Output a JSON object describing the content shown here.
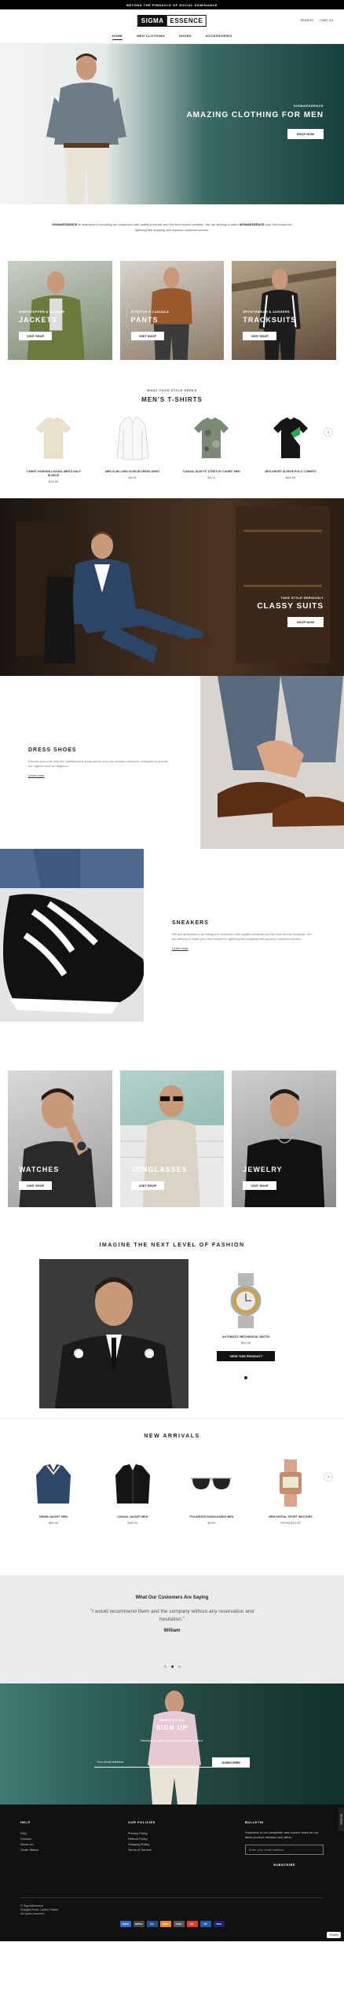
{
  "topbar": {
    "text": "BEYOND THE PINNACLE OF SOCIAL DOMINANCE"
  },
  "header": {
    "logo_part1": "SIGMA",
    "logo_part2": "ESSENCE",
    "search_label": "SEARCH",
    "cart_label": "CART (0)",
    "nav": [
      "HOME",
      "MEN CLOTHING",
      "SHOES",
      "ACCESSORIES"
    ]
  },
  "hero": {
    "kicker": "SIGMAESSENCE",
    "title": "AMAZING CLOTHING FOR MEN",
    "button": "SHOP NOW"
  },
  "intro": {
    "brand": "SIGMAESSENCE",
    "text1": " is dedicated to providing our customers with quality products and the best service possible. We are striving to make ",
    "brand2": "SIGMAESSENCE",
    "text2": " your first choice for lightning fast shipping and superior customer service."
  },
  "categories_top": [
    {
      "kicker": "WINDSTOPPER & BOMBER",
      "title": "JACKETS",
      "button": "VISIT SHOP"
    },
    {
      "kicker": "STRETCH & CASUALS",
      "title": "PANTS",
      "button": "VISIT SHOP"
    },
    {
      "kicker": "SPORTSWEAR & JOGGERS",
      "title": "TRACKSUITS",
      "button": "VISIT SHOP"
    }
  ],
  "tshirts": {
    "kicker": "WHAT YOUR STYLE SEEKS",
    "title": "MEN'S T-SHIRTS",
    "products": [
      {
        "name": "T-SHIRT FASHION CASUAL MEN'S HALF SLEEVE",
        "price": "$14.99"
      },
      {
        "name": "MEN SLIM LONG SLEEVE DRESS SHIRT",
        "price": "$9.99"
      },
      {
        "name": "CASUAL SLIM FIT STRETCH T-SHIRT MEN",
        "price": "$8.72"
      },
      {
        "name": "MEN SHORT SLEEVE POLO T-SHIRTS",
        "price": "$16.99"
      }
    ]
  },
  "suits": {
    "kicker": "TAKE STYLE SERIOUSLY",
    "title": "CLASSY SUITS",
    "button": "SHOP NOW"
  },
  "dress_shoes": {
    "title": "DRESS SHOES",
    "desc": "Elevate your look with the sophisticated dress shoes from our curated collection, designed to provide the highest level of elegance.",
    "link": "Learn more"
  },
  "sneakers": {
    "title": "SNEAKERS",
    "desc": "We are dedicated to providing our customers with quality products and the best service possible. We are striving to make your first choice for lightning fast shipping and superior customer service.",
    "link": "Learn more"
  },
  "categories_bottom": [
    {
      "title": "WATCHES",
      "button": "VISIT SHOP"
    },
    {
      "title": "SUNGLASSES",
      "button": "VISIT SHOP"
    },
    {
      "title": "JEWELRY",
      "button": "VISIT SHOP"
    }
  ],
  "fashion": {
    "title": "IMAGINE THE NEXT LEVEL OF FASHION",
    "product_name": "AUTOMATIC MECHANICAL WATCH",
    "product_price": "$54.99",
    "button": "VIEW THIS PRODUCT"
  },
  "arrivals": {
    "title": "NEW ARRIVALS",
    "products": [
      {
        "name": "DENIM JACKET MEN",
        "price": "$56.99"
      },
      {
        "name": "CASUAL JACKET MEN",
        "price": "$39.99"
      },
      {
        "name": "POLARIZED SUNGLASSES MEN",
        "price": "$8.99"
      },
      {
        "name": "MEN DIGITAL SPORT WATCHES",
        "price": "FROM $19.99"
      }
    ]
  },
  "testimonial": {
    "heading": "What Our Customers Are Saying",
    "quote": "\"I would recommend them and the company without any reservation and hesitation.\"",
    "author": "William"
  },
  "newsletter": {
    "kicker": "NEWSLETTER",
    "title": "SIGN UP",
    "desc": "Receive the latest news and exclusive offers.",
    "placeholder": "Your email address",
    "button": "SUBSCRIBE"
  },
  "footer": {
    "col1_title": "HELP",
    "col1_items": [
      "FAQ",
      "Contact",
      "About Us",
      "Order Status"
    ],
    "col2_title": "OUR POLICIES",
    "col2_items": [
      "Privacy Policy",
      "Refund Policy",
      "Shipping Policy",
      "Terms of Service"
    ],
    "col3_title": "BULLETIN",
    "col3_desc": "Subscribe to our newsletter and receive news on our latest product releases and offers.",
    "col3_placeholder": "Enter your email address",
    "col3_button": "SUBSCRIBE",
    "copyright": "© SigmaEssence",
    "address": "Straight Road, United States",
    "rights": "All rights reserved.",
    "payments": [
      "AMEX",
      "APPLE",
      "DC",
      "DISC",
      "GPAY",
      "MC",
      "PP",
      "VISA"
    ]
  },
  "badge": {
    "text": "Shopify"
  },
  "side_tab": {
    "text": "REVIEWS"
  }
}
